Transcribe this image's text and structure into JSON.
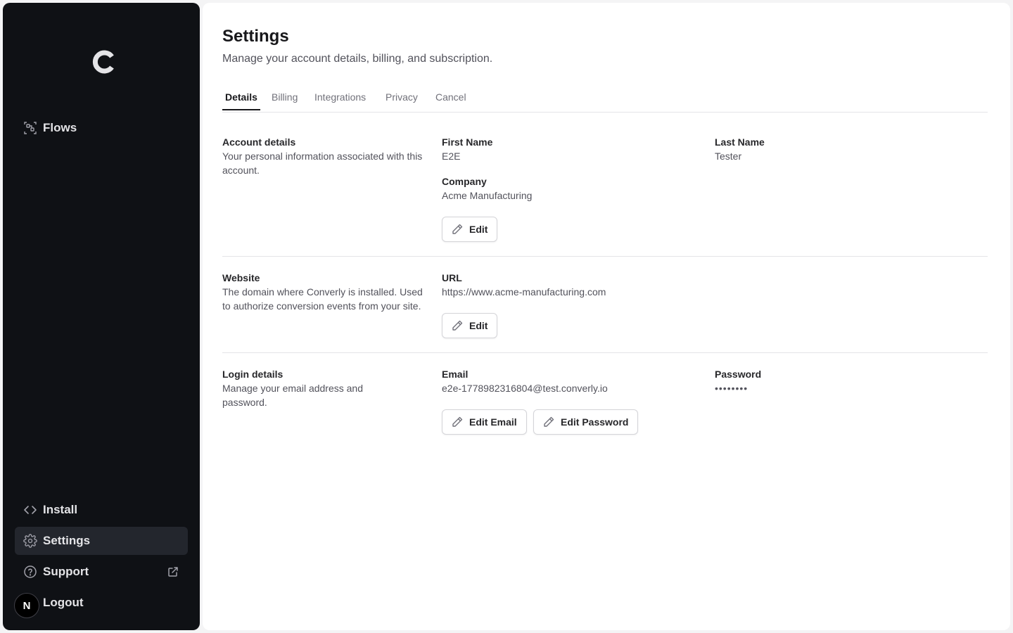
{
  "sidebar": {
    "logo_icon": "converly-c-logo",
    "items": [
      {
        "label": "Flows",
        "icon": "flows-icon"
      },
      {
        "label": "Install",
        "icon": "code-icon"
      },
      {
        "label": "Settings",
        "icon": "gear-icon",
        "active": true
      },
      {
        "label": "Support",
        "icon": "help-circle-icon",
        "trailing_icon": "external-link-icon"
      },
      {
        "label": "Logout"
      }
    ],
    "avatar_initial": "N"
  },
  "header": {
    "title": "Settings",
    "subtitle": "Manage your account details, billing, and subscription."
  },
  "tabs": [
    {
      "label": "Details",
      "active": true
    },
    {
      "label": "Billing"
    },
    {
      "label": "Integrations"
    },
    {
      "label": "Privacy"
    },
    {
      "label": "Cancel"
    }
  ],
  "account": {
    "title": "Account details",
    "description": "Your personal information associated with this account.",
    "first_name_label": "First Name",
    "first_name": "E2E",
    "last_name_label": "Last Name",
    "last_name": "Tester",
    "company_label": "Company",
    "company": "Acme Manufacturing",
    "edit_label": "Edit"
  },
  "website": {
    "title": "Website",
    "description": "The domain where Converly is installed. Used to authorize conversion events from your site.",
    "url_label": "URL",
    "url": "https://www.acme-manufacturing.com",
    "edit_label": "Edit"
  },
  "login": {
    "title": "Login details",
    "description": "Manage your email address and password.",
    "email_label": "Email",
    "email": "e2e-1778982316804@test.converly.io",
    "password_label": "Password",
    "password": "••••••••",
    "edit_email_label": "Edit Email",
    "edit_password_label": "Edit Password"
  },
  "colors": {
    "sidebar_bg": "#0f1115",
    "sidebar_active": "#23262d",
    "page_bg": "#ffffff",
    "divider": "#e4e4e7"
  }
}
